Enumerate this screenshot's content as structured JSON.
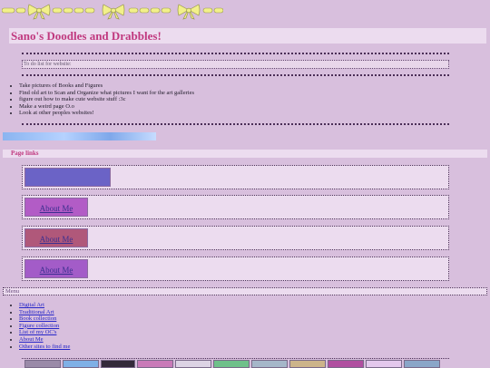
{
  "site": {
    "title": "Sano's Doodles and Drabbles!"
  },
  "todo": {
    "heading": "To do list for website:",
    "items": [
      "Take pictures of Books and Figures",
      "Find old art to Scan and Organize what pictures I want for the art galleries",
      "figure out how to make cute website stuff :3c",
      "Make a weird page O.o",
      "Look at other peoples websites!"
    ]
  },
  "page_links": {
    "heading": "Page links",
    "buttons": [
      {
        "label": "",
        "color": "#6b63c6"
      },
      {
        "label": "About Me",
        "color": "#b25cc6"
      },
      {
        "label": "About Me",
        "color": "#b0587a"
      },
      {
        "label": "About Me",
        "color": "#a35cc8"
      }
    ]
  },
  "menu": {
    "heading": "Menu",
    "items": [
      "Digital Art",
      "Traditional Art",
      "Book collection",
      "Figure collection",
      "List of my OC's",
      "About Me",
      "Other sites to find me"
    ]
  },
  "colors": {
    "background": "#d8bfdd",
    "panel": "#ecdcef",
    "heading_text": "#c0397f",
    "link": "#2525c8",
    "bow": "#f2f08a"
  },
  "icons": {
    "banner": "bow-icon",
    "bullet": "disc-bullet"
  },
  "stamps": [
    "#9a8aa8",
    "#7fb0e6",
    "#332a3a",
    "#c97ab8",
    "#dcd3e4",
    "#6fc08a",
    "#a5b7c9",
    "#ccb48a",
    "#b04fa0",
    "#e3c8ec",
    "#8aa6c8"
  ]
}
